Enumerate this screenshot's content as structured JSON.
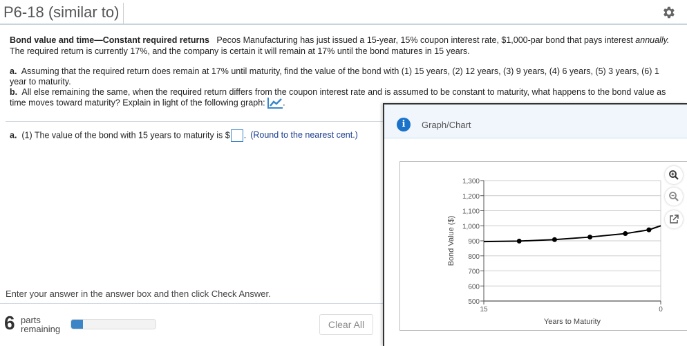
{
  "header": {
    "title": "P6-18 (similar to)",
    "settings_icon": "gear-icon"
  },
  "problem": {
    "heading": "Bond value and time—Constant required returns",
    "intro": "Pecos Manufacturing has just issued a 15-year, 15% coupon interest rate, $1,000-par bond that pays interest",
    "intro_italic": "annually.",
    "intro_rest": "The required return is currently 17%, and the company is certain it will remain at 17% until the bond matures in 15 years.",
    "part_a_label": "a.",
    "part_a_text": "Assuming that the required return does remain at 17% until maturity, find the value of the bond with (1) 15 years, (2) 12 years, (3) 9 years, (4) 6 years, (5) 3 years, (6) 1 year to maturity.",
    "part_b_label": "b.",
    "part_b_text": "All else remaining the same, when the required return differs from the coupon interest rate and is assumed to be constant to maturity, what happens to the bond value as time moves toward maturity?  Explain in light of the following graph:",
    "graph_link_icon": "line-chart-icon"
  },
  "answer": {
    "label": "a.",
    "text": "(1) The value of the bond with 15 years to maturity is $",
    "value": "",
    "after": ".",
    "hint": "(Round to the nearest cent.)"
  },
  "footer": {
    "instruction": "Enter your answer in the answer box and then click Check Answer.",
    "parts_count": "6",
    "parts_label_1": "parts",
    "parts_label_2": "remaining",
    "progress_fraction": 0.14,
    "clear_all": "Clear All"
  },
  "popup": {
    "title": "Graph/Chart",
    "tools": [
      "zoom-in-icon",
      "zoom-out-icon",
      "open-external-icon"
    ]
  },
  "chart_data": {
    "type": "line",
    "title": "",
    "xlabel": "Years to Maturity",
    "ylabel": "Bond Value ($)",
    "x": [
      15,
      12,
      9,
      6,
      3,
      1,
      0
    ],
    "values": [
      895,
      898,
      908,
      925,
      948,
      973,
      1000
    ],
    "markers_at": [
      12,
      9,
      6,
      3,
      1
    ],
    "xlim": [
      15,
      0
    ],
    "ylim": [
      500,
      1300
    ],
    "yticks": [
      "500",
      "600",
      "700",
      "800",
      "900",
      "1,000",
      "1,100",
      "1,200",
      "1,300"
    ],
    "xticks": [
      "15",
      "0"
    ],
    "grid": true,
    "line_color": "#000000"
  }
}
